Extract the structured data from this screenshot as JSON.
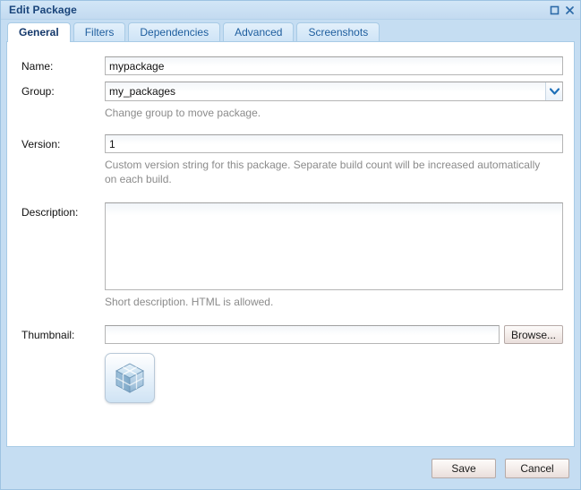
{
  "window": {
    "title": "Edit Package",
    "controls": [
      {
        "name": "maximize-button",
        "icon": "maximize-icon",
        "label": "□"
      },
      {
        "name": "close-button",
        "icon": "close-icon",
        "label": "×"
      }
    ]
  },
  "tabs": [
    {
      "label": "General",
      "active": true
    },
    {
      "label": "Filters",
      "active": false
    },
    {
      "label": "Dependencies",
      "active": false
    },
    {
      "label": "Advanced",
      "active": false
    },
    {
      "label": "Screenshots",
      "active": false
    }
  ],
  "form": {
    "name": {
      "label": "Name:",
      "value": "mypackage",
      "placeholder": ""
    },
    "group": {
      "label": "Group:",
      "value": "my_packages",
      "placeholder": "",
      "hint": "Change group to move package.",
      "arrow_icon": "chevron-down-icon"
    },
    "version": {
      "label": "Version:",
      "value": "1",
      "placeholder": "",
      "hint": "Custom version string for this package. Separate build count will be increased automatically on each build."
    },
    "description": {
      "label": "Description:",
      "value": "",
      "placeholder": "",
      "hint": "Short description. HTML is allowed."
    },
    "thumbnail": {
      "label": "Thumbnail:",
      "value": "",
      "placeholder": "",
      "browse_label": "Browse...",
      "preview_icon": "package-cube-icon"
    }
  },
  "footer": {
    "save_label": "Save",
    "cancel_label": "Cancel"
  },
  "colors": {
    "window_chrome": "#c5ddf2",
    "title_text": "#19447a",
    "tab_text": "#1d5d9e",
    "hint_text": "#8b8b8b",
    "panel_border": "#a8cbe6"
  }
}
